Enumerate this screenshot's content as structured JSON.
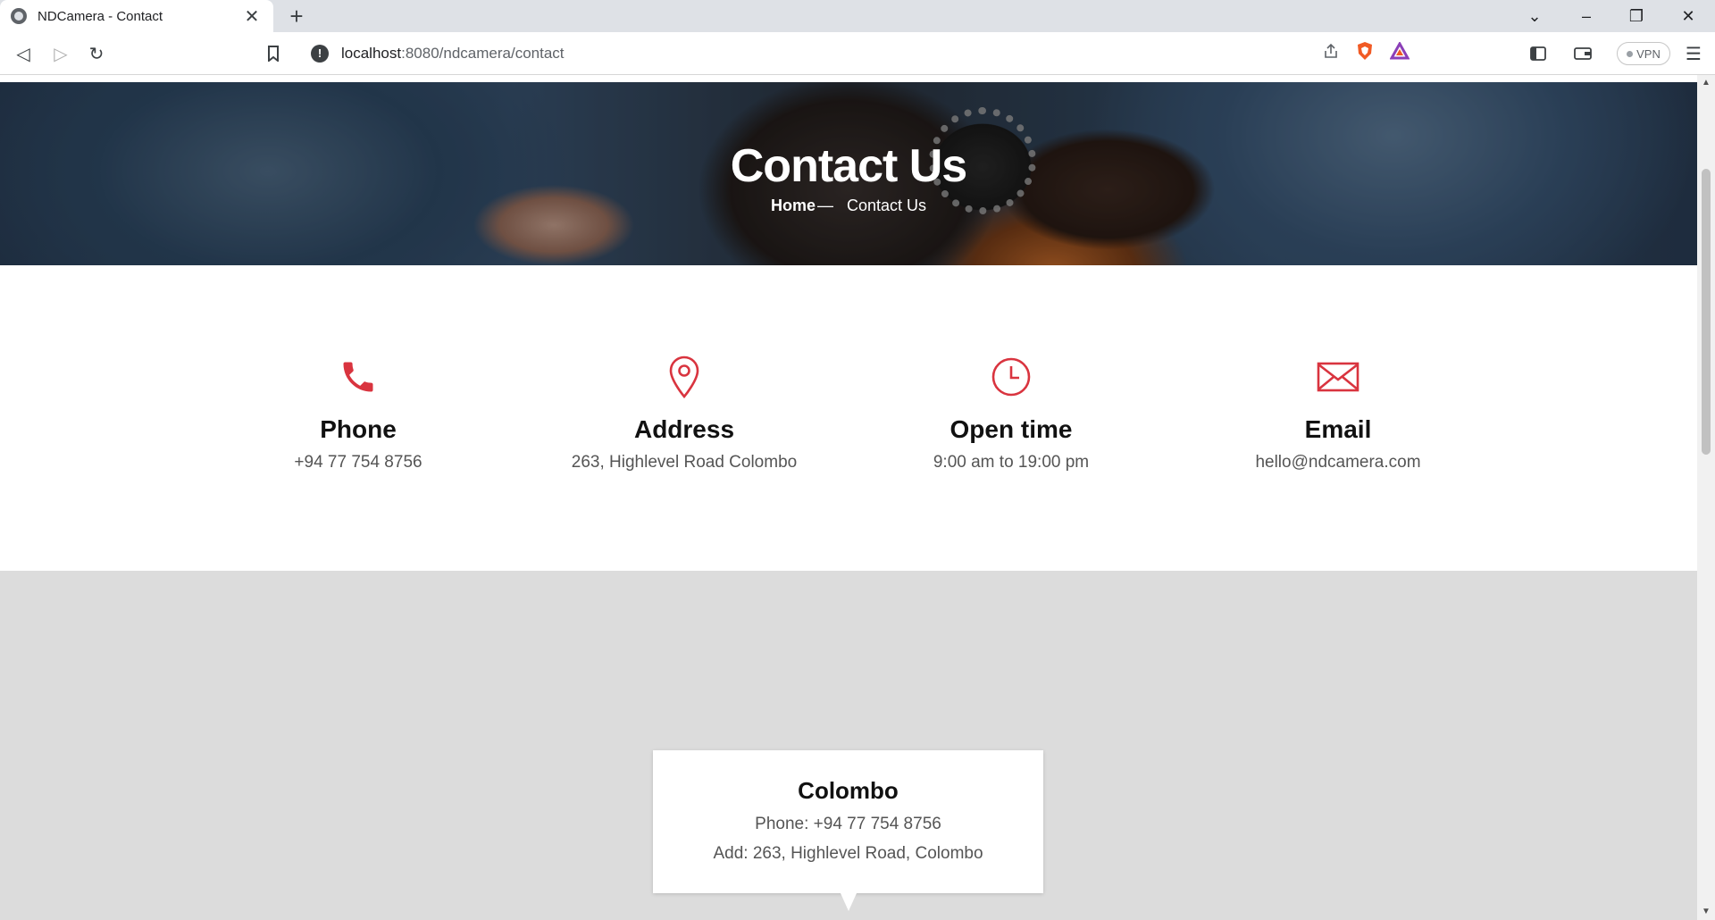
{
  "browser": {
    "tab_title": "NDCamera - Contact",
    "url_host": "localhost",
    "url_path": ":8080/ndcamera/contact",
    "vpn_label": "VPN"
  },
  "hero": {
    "title": "Contact Us",
    "breadcrumb": {
      "home": "Home",
      "separator": "—",
      "current": "Contact Us"
    }
  },
  "contact_info": [
    {
      "icon": "phone-icon",
      "heading": "Phone",
      "value": "+94 77 754 8756"
    },
    {
      "icon": "map-pin-icon",
      "heading": "Address",
      "value": "263, Highlevel Road Colombo"
    },
    {
      "icon": "clock-icon",
      "heading": "Open time",
      "value": "9:00 am to 19:00 pm"
    },
    {
      "icon": "mail-icon",
      "heading": "Email",
      "value": "hello@ndcamera.com"
    }
  ],
  "map_popup": {
    "title": "Colombo",
    "phone": "Phone: +94 77 754 8756",
    "address": "Add: 263, Highlevel Road, Colombo"
  },
  "colors": {
    "accent": "#d9343f",
    "map_bg": "#dcdcdc"
  }
}
